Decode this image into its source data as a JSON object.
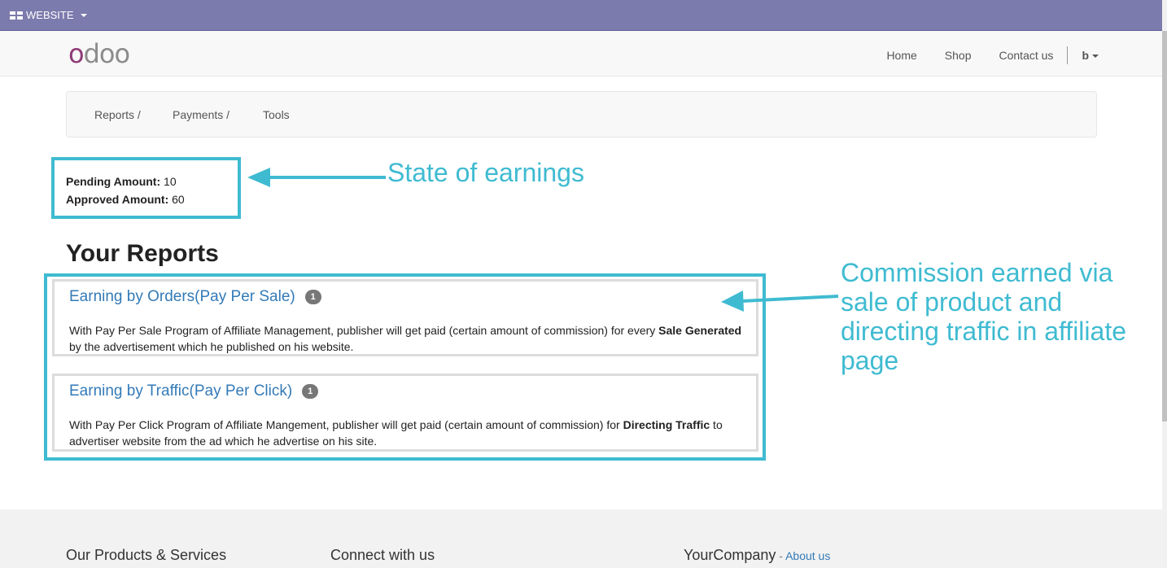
{
  "topbar": {
    "menu_label": "WEBSITE",
    "color": "#7c7bad"
  },
  "navbar": {
    "logo_first": "o",
    "logo_rest": "doo",
    "links": [
      "Home",
      "Shop",
      "Contact us"
    ],
    "user": "b"
  },
  "breadcrumb": [
    "Reports /",
    "Payments /",
    "Tools"
  ],
  "amounts": {
    "pending_label": "Pending Amount:",
    "pending_value": " 10",
    "approved_label": "Approved Amount:",
    "approved_value": " 60"
  },
  "annotations": {
    "state": "State of earnings",
    "commission_lines": [
      "Commission earned via",
      "sale of product and",
      "directing traffic in affiliate",
      "page"
    ],
    "color": "#3fbbd1"
  },
  "reports": {
    "title": "Your Reports",
    "cards": [
      {
        "title": "Earning by Orders(Pay Per Sale)",
        "badge": "1",
        "desc_pre": "With Pay Per Sale Program of Affiliate Management, publisher will get paid (certain amount of commission) for every ",
        "desc_bold": "Sale Generated",
        "desc_post": " by the advertisement which he published on his website."
      },
      {
        "title": "Earning by Traffic(Pay Per Click)",
        "badge": "1",
        "desc_pre": "With Pay Per Click Program of Affiliate Mangement, publisher will get paid (certain amount of commission) for ",
        "desc_bold": "Directing Traffic",
        "desc_post": " to advertiser website from the ad which he advertise on his site."
      }
    ]
  },
  "footer": {
    "col1": "Our Products & Services",
    "col2": "Connect with us",
    "col3": "YourCompany",
    "col3_dash": " - ",
    "col3_link": "About us"
  }
}
